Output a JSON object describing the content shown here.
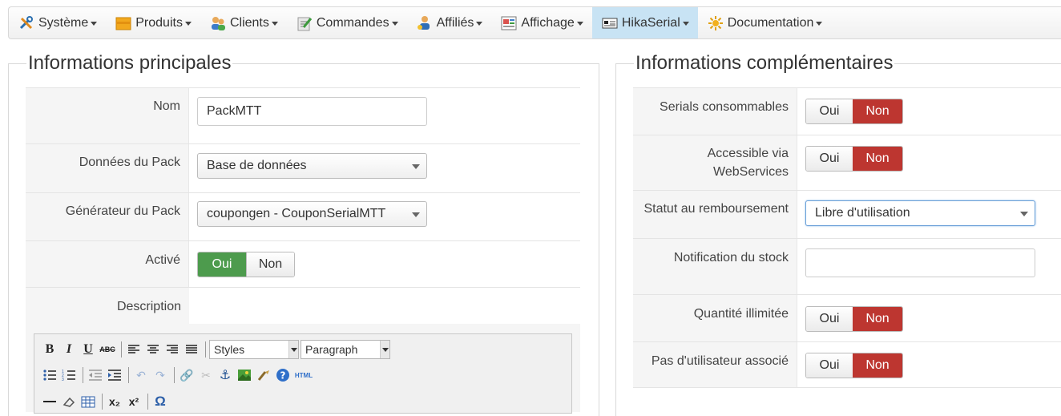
{
  "menu": [
    {
      "label": "Système",
      "icon": "tools-icon",
      "active": false
    },
    {
      "label": "Produits",
      "icon": "box-icon",
      "active": false
    },
    {
      "label": "Clients",
      "icon": "users-icon",
      "active": false
    },
    {
      "label": "Commandes",
      "icon": "order-icon",
      "active": false
    },
    {
      "label": "Affiliés",
      "icon": "affiliates-icon",
      "active": false
    },
    {
      "label": "Affichage",
      "icon": "display-icon",
      "active": false
    },
    {
      "label": "HikaSerial",
      "icon": "serial-icon",
      "active": true
    },
    {
      "label": "Documentation",
      "icon": "help-icon",
      "active": false
    }
  ],
  "main": {
    "legend": "Informations principales",
    "nom_label": "Nom",
    "nom_value": "PackMTT",
    "data_label": "Données du Pack",
    "data_value": "Base de données",
    "generator_label": "Générateur du Pack",
    "generator_value": "coupongen - CouponSerialMTT",
    "active_label": "Activé",
    "active_yes": "Oui",
    "active_no": "Non",
    "active_value": "Oui",
    "description_label": "Description"
  },
  "editor": {
    "styles_label": "Styles",
    "format_label": "Paragraph",
    "html_label": "HTML"
  },
  "extra": {
    "legend": "Informations complémentaires",
    "consumable_label": "Serials consommables",
    "webservices_label_1": "Accessible via",
    "webservices_label_2": "WebServices",
    "refund_label": "Statut au remboursement",
    "refund_value": "Libre d'utilisation",
    "stock_label": "Notification du stock",
    "stock_value": "",
    "unlimited_label": "Quantité illimitée",
    "nouser_label": "Pas d'utilisateur associé",
    "yes": "Oui",
    "no": "Non"
  },
  "colors": {
    "active_menu": "#c8e3f4",
    "toggle_green": "#4d9b4d",
    "toggle_red": "#bd3630"
  }
}
